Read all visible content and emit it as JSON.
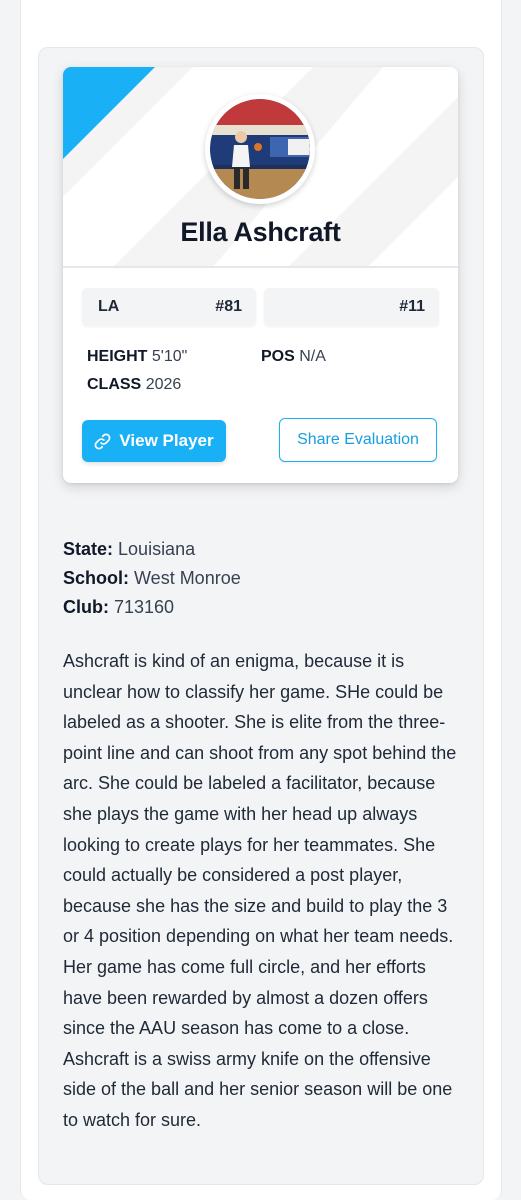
{
  "player": {
    "name": "Ella Ashcraft",
    "state_code": "LA",
    "number_primary": "#81",
    "number_secondary": "#11",
    "height_label": "HEIGHT",
    "height_value": "5'10\"",
    "pos_label": "POS",
    "pos_value": "N/A",
    "class_label": "CLASS",
    "class_value": "2026"
  },
  "actions": {
    "view_player_label": "View Player",
    "view_player_icon": "link-icon",
    "share_label": "Share Evaluation"
  },
  "details": {
    "state_label": "State:",
    "state_value": "Louisiana",
    "school_label": "School:",
    "school_value": "West Monroe",
    "club_label": "Club:",
    "club_value": "713160"
  },
  "evaluation": "Ashcraft is kind of an enigma, because it is unclear how to classify her game. SHe could be labeled as a shooter. She is elite from the three-point line and can shoot from any spot behind the arc. She could be labeled a facilitator, because she plays the game with her head up always looking to create plays for her teammates. She could actually be considered a post player, because she has the size and build to play the 3 or 4 position depending on what her team needs. Her game has come full circle, and her efforts have been rewarded by almost a dozen offers since the AAU season has come to a close. Ashcraft is a swiss army knife on the offensive side of the ball and her senior season will be one to watch for sure.",
  "colors": {
    "accent": "#1ab0f5",
    "page_background": "#f3f4f6",
    "card_background": "#ffffff"
  }
}
